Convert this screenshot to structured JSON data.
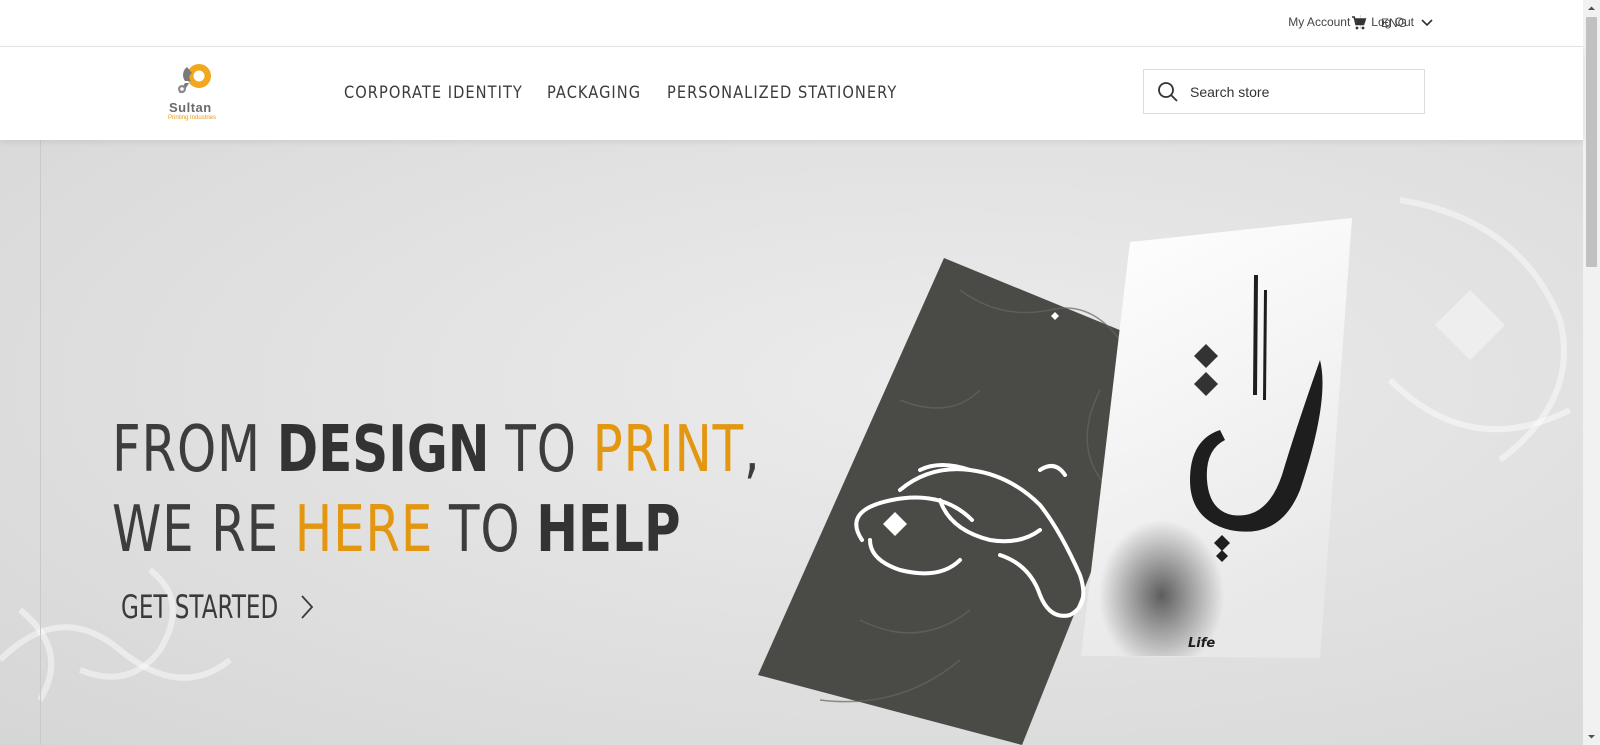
{
  "topbar": {
    "my_account": "My Account",
    "log_out": "Log Out",
    "language": "ENG"
  },
  "header": {
    "logo": {
      "brand": "Sultan",
      "sub": "Printing Industries"
    },
    "nav": [
      {
        "label": "CORPORATE IDENTITY"
      },
      {
        "label": "PACKAGING"
      },
      {
        "label": "PERSONALIZED STATIONERY"
      }
    ],
    "search": {
      "placeholder": "Search store"
    }
  },
  "hero": {
    "headline": {
      "w1": "FROM",
      "w2": "DESIGN",
      "w3": "TO",
      "w4": "PRINT",
      "w5": ",",
      "w6": "WE RE",
      "w7": "HERE",
      "w8": "TO",
      "w9": "HELP"
    },
    "cta": "GET STARTED",
    "poster_caption": "Life"
  },
  "colors": {
    "accent": "#e3960f",
    "text_dark": "#333333"
  },
  "icons": [
    "cart-icon",
    "chevron-down-icon",
    "search-icon",
    "chevron-right-icon"
  ]
}
